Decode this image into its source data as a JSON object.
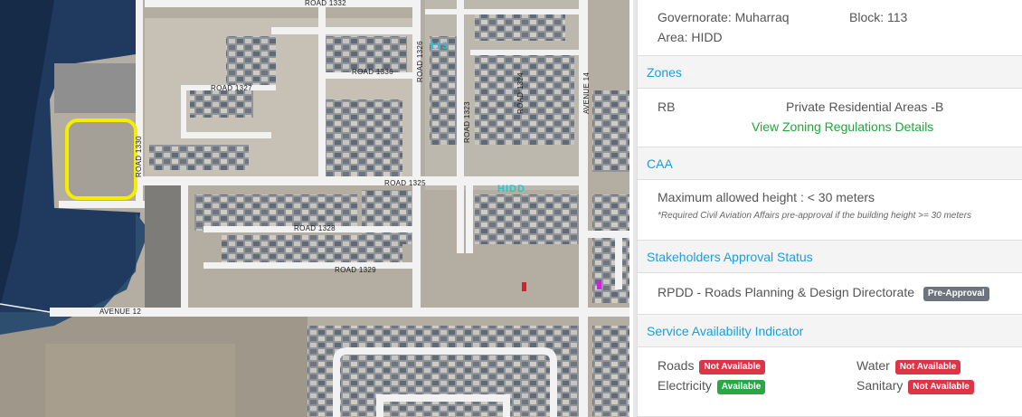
{
  "map": {
    "road_labels": [
      "ROAD 1332",
      "ROAD 1336",
      "ROAD 1327",
      "ROAD 1325",
      "ROAD 1328",
      "ROAD 1329",
      "ROAD 1330",
      "ROAD 1326",
      "ROAD 1323",
      "ROAD 1324",
      "AVENUE 14",
      "AVENUE 12"
    ],
    "area_number": "113",
    "area_name": "HIDD",
    "colors": {
      "parcel_highlight": "#f5ee00",
      "water": "#1f3a5e",
      "road": "#f2f2f2"
    }
  },
  "panel": {
    "location": {
      "governorate": "Governorate: Muharraq",
      "block": "Block: 113",
      "area": "Area: HIDD"
    },
    "zones": {
      "title": "Zones",
      "code": "RB",
      "name": "Private Residential Areas -B",
      "link": "View Zoning Regulations Details"
    },
    "caa": {
      "title": "CAA",
      "max_height": "Maximum allowed height : < 30 meters",
      "note": "*Required Civil Aviation Affairs pre-approval if the building height >= 30 meters"
    },
    "stakeholders": {
      "title": "Stakeholders Approval Status",
      "item": "RPDD - Roads Planning & Design Directorate",
      "badge": "Pre-Approval"
    },
    "services": {
      "title": "Service Availability Indicator",
      "items": [
        {
          "label": "Roads",
          "status": "Not Available"
        },
        {
          "label": "Water",
          "status": "Not Available"
        },
        {
          "label": "Electricity",
          "status": "Available"
        },
        {
          "label": "Sanitary",
          "status": "Not Available"
        }
      ]
    }
  }
}
